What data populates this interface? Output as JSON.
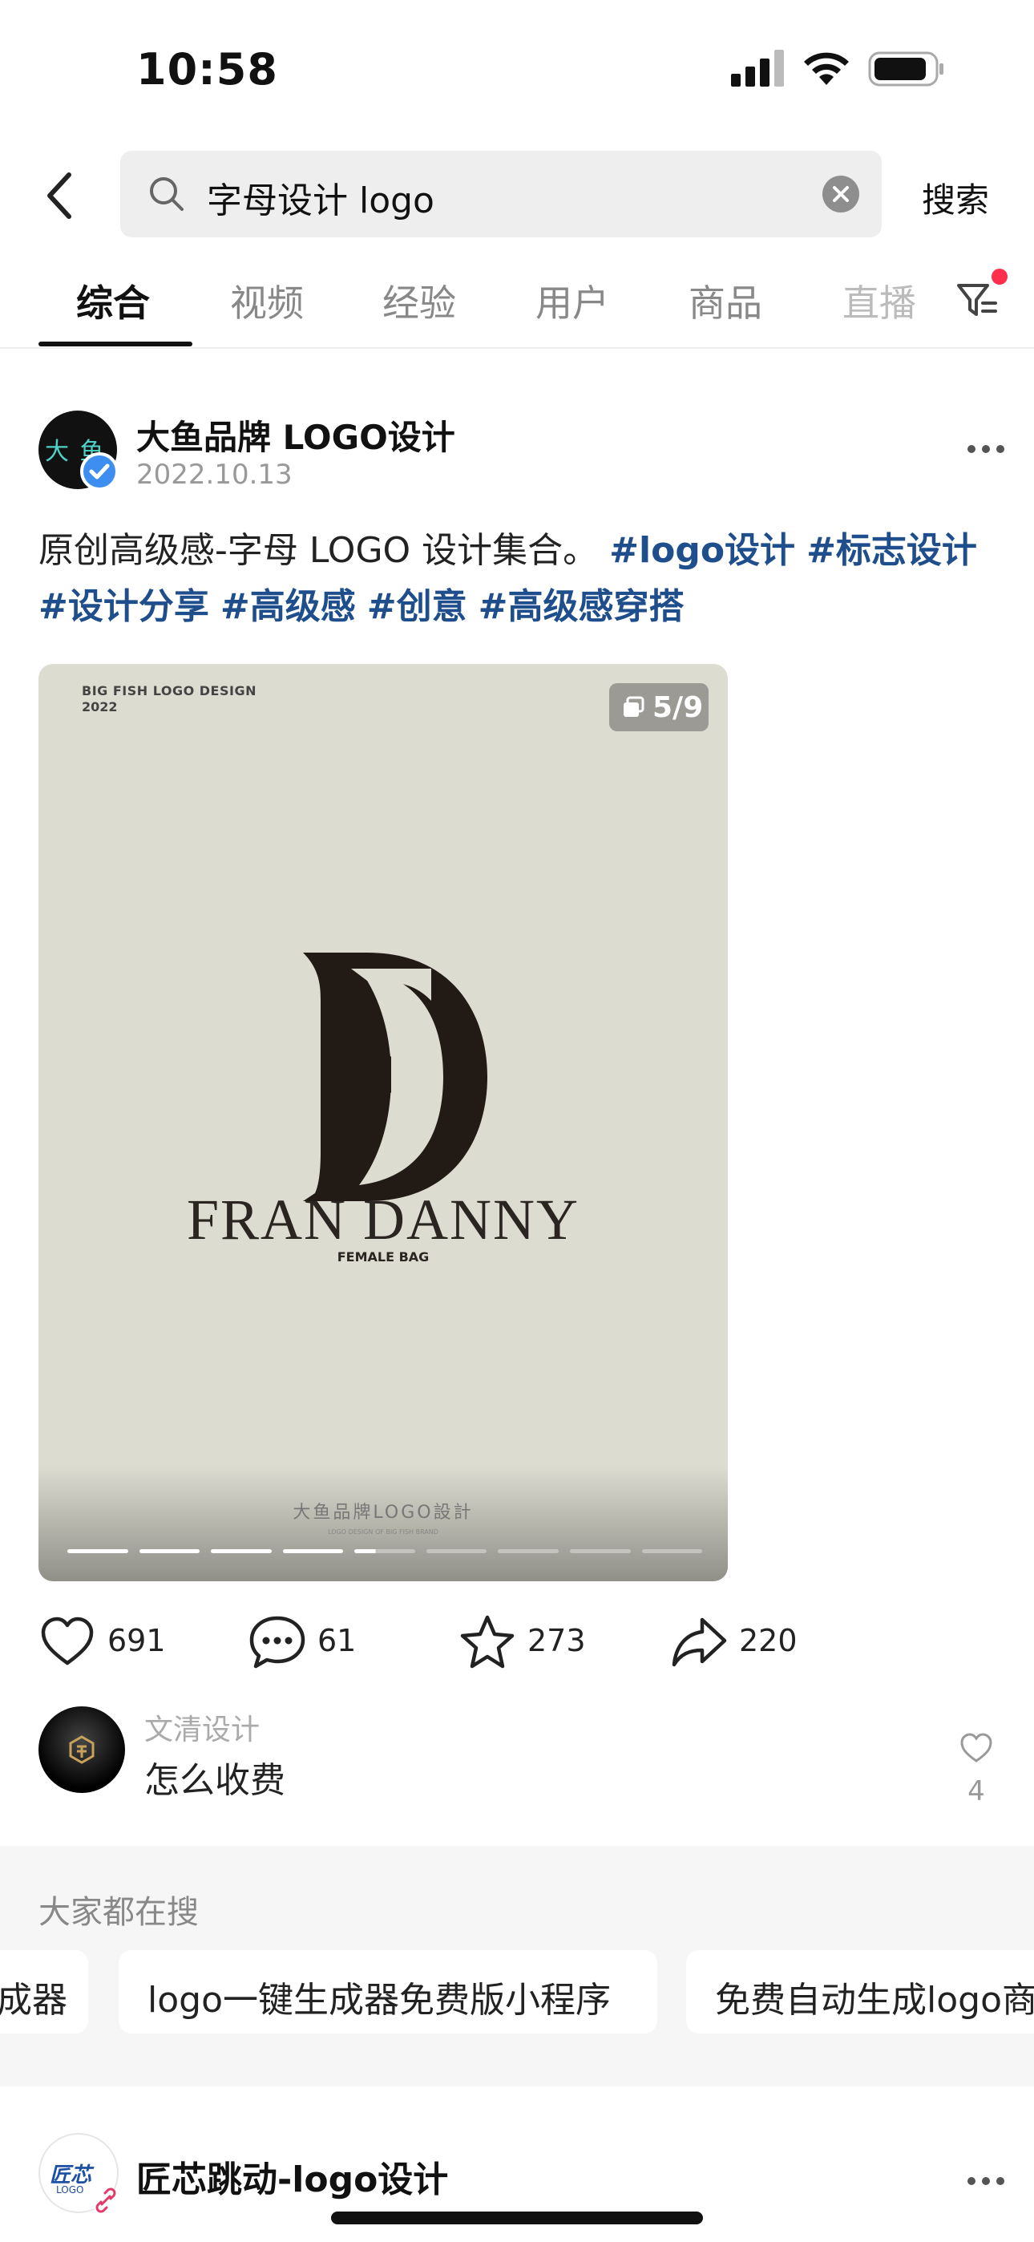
{
  "status": {
    "time": "10:58"
  },
  "search": {
    "query": "字母设计 logo",
    "button": "搜索"
  },
  "tabs": [
    "综合",
    "视频",
    "经验",
    "用户",
    "商品",
    "直播"
  ],
  "post": {
    "author": "大鱼品牌 LOGO设计",
    "avatar_text": "大 鱼",
    "date": "2022.10.13",
    "caption_text": "原创高级感-字母 LOGO 设计集合。",
    "tags": [
      "#logo设计",
      "#标志设计",
      "#设计分享",
      "#高级感",
      "#创意",
      "#高级感穿搭"
    ],
    "image": {
      "header_line1": "BIG FISH LOGO DESIGN",
      "header_line2": "2022",
      "counter": "5/9",
      "monogram": "FD",
      "brand": "FRAN DANNY",
      "brand_sub": "FEMALE BAG",
      "footer": "大鱼品牌LOGO設計",
      "footer_sub": "LOGO DESIGN OF BIG FISH BRAND",
      "pages_total": 9,
      "page_current": 5
    },
    "likes": "691",
    "comments": "61",
    "favorites": "273",
    "shares": "220",
    "top_comment": {
      "user": "文清设计",
      "text": "怎么收费",
      "likes": "4"
    }
  },
  "trending": {
    "title": "大家都在搜",
    "chips": [
      "成器",
      "logo一键生成器免费版小程序",
      "免费自动生成logo商"
    ]
  },
  "post2": {
    "author": "匠芯跳动-logo设计",
    "avatar_text": "匠芯",
    "avatar_sub": "LOGO"
  },
  "colors": {
    "accent_tag": "#1f4e8c",
    "notification_dot": "#ff2e4d",
    "verify_badge": "#3d8ef0"
  }
}
